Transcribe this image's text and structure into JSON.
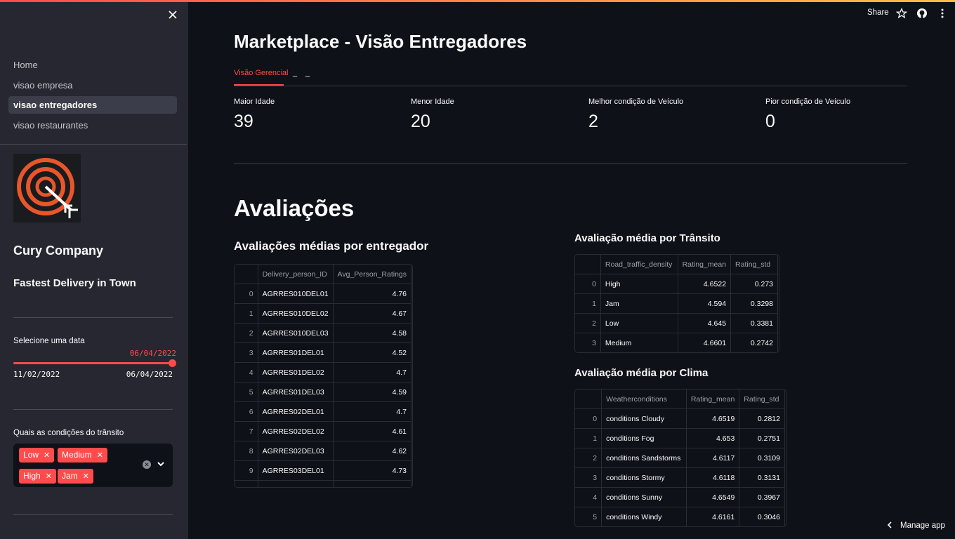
{
  "sidebar": {
    "nav_items": [
      {
        "label": "Home"
      },
      {
        "label": "visao empresa"
      },
      {
        "label": "visao entregadores",
        "active": true
      },
      {
        "label": "visao restaurantes"
      }
    ],
    "brand": "Cury Company",
    "tagline": "Fastest Delivery in Town",
    "date_slider": {
      "label": "Selecione uma data",
      "value": "06/04/2022",
      "min": "11/02/2022",
      "max": "06/04/2022",
      "fraction": 1.0
    },
    "traffic": {
      "label": "Quais as condições do trânsito",
      "tags": [
        "Low",
        "Medium",
        "High",
        "Jam"
      ]
    }
  },
  "header": {
    "share": "Share",
    "manage_app": "Manage app"
  },
  "main": {
    "title": "Marketplace - Visão Entregadores",
    "tabs": [
      "Visão Gerencial",
      "_",
      "_"
    ],
    "metrics": [
      {
        "label": "Maior Idade",
        "value": "39"
      },
      {
        "label": "Menor Idade",
        "value": "20"
      },
      {
        "label": "Melhor condição de Veículo",
        "value": "2"
      },
      {
        "label": "Pior condição de Veículo",
        "value": "0"
      }
    ],
    "section_title": "Avaliações",
    "ratings_table": {
      "title": "Avaliações médias por entregador",
      "columns": [
        "",
        "Delivery_person_ID",
        "Avg_Person_Ratings"
      ],
      "rows": [
        [
          "0",
          "AGRRES010DEL01",
          "4.76"
        ],
        [
          "1",
          "AGRRES010DEL02",
          "4.67"
        ],
        [
          "2",
          "AGRRES010DEL03",
          "4.58"
        ],
        [
          "3",
          "AGRRES01DEL01",
          "4.52"
        ],
        [
          "4",
          "AGRRES01DEL02",
          "4.7"
        ],
        [
          "5",
          "AGRRES01DEL03",
          "4.59"
        ],
        [
          "6",
          "AGRRES02DEL01",
          "4.7"
        ],
        [
          "7",
          "AGRRES02DEL02",
          "4.61"
        ],
        [
          "8",
          "AGRRES02DEL03",
          "4.62"
        ],
        [
          "9",
          "AGRRES03DEL01",
          "4.73"
        ]
      ]
    },
    "traffic_table": {
      "title": "Avaliação média por Trânsito",
      "columns": [
        "",
        "Road_traffic_density",
        "Rating_mean",
        "Rating_std"
      ],
      "rows": [
        [
          "0",
          "High",
          "4.6522",
          "0.273"
        ],
        [
          "1",
          "Jam",
          "4.594",
          "0.3298"
        ],
        [
          "2",
          "Low",
          "4.645",
          "0.3381"
        ],
        [
          "3",
          "Medium",
          "4.6601",
          "0.2742"
        ]
      ]
    },
    "weather_table": {
      "title": "Avaliação média por Clima",
      "columns": [
        "",
        "Weatherconditions",
        "Rating_mean",
        "Rating_std"
      ],
      "rows": [
        [
          "0",
          "conditions Cloudy",
          "4.6519",
          "0.2812"
        ],
        [
          "1",
          "conditions Fog",
          "4.653",
          "0.2751"
        ],
        [
          "2",
          "conditions Sandstorms",
          "4.6117",
          "0.3109"
        ],
        [
          "3",
          "conditions Stormy",
          "4.6118",
          "0.3131"
        ],
        [
          "4",
          "conditions Sunny",
          "4.6549",
          "0.3967"
        ],
        [
          "5",
          "conditions Windy",
          "4.6161",
          "0.3046"
        ]
      ]
    }
  },
  "colors": {
    "accent": "#ff4b4b",
    "background": "#0e1117",
    "sidebar": "#262730"
  }
}
